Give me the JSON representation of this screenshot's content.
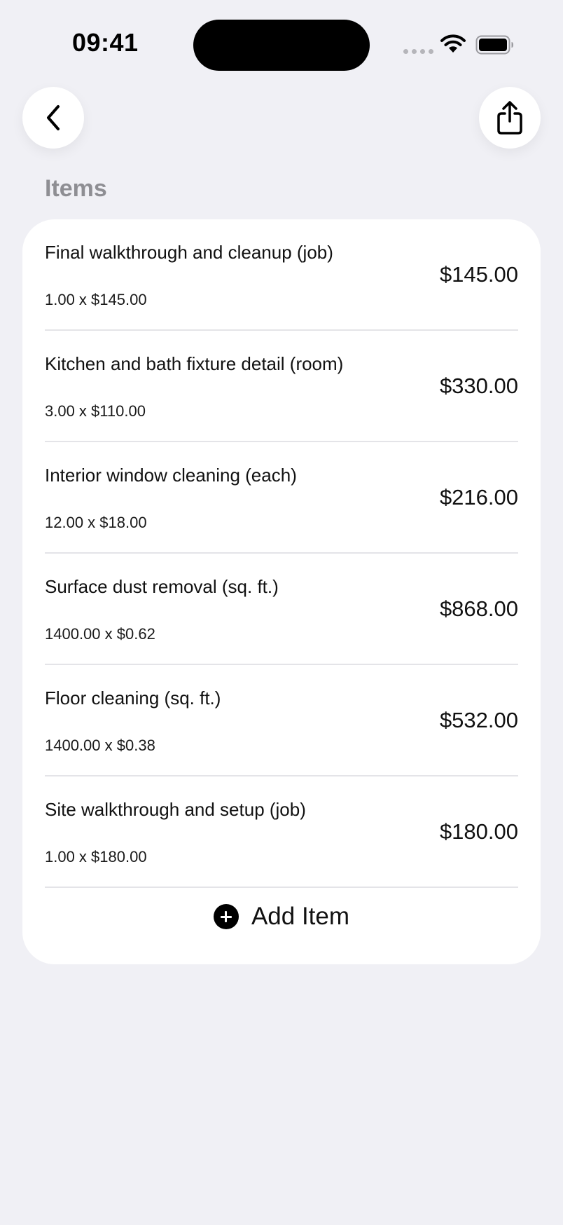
{
  "status_bar": {
    "time": "09:41"
  },
  "nav": {
    "back_icon": "chevron-left-icon",
    "share_icon": "share-icon"
  },
  "section": {
    "title": "Items"
  },
  "items": [
    {
      "name": "Final walkthrough and cleanup (job)",
      "qty_line": "1.00 x $145.00",
      "amount": "$145.00"
    },
    {
      "name": "Kitchen and bath fixture detail (room)",
      "qty_line": "3.00 x $110.00",
      "amount": "$330.00"
    },
    {
      "name": "Interior window cleaning (each)",
      "qty_line": "12.00 x $18.00",
      "amount": "$216.00"
    },
    {
      "name": "Surface dust removal (sq. ft.)",
      "qty_line": "1400.00 x $0.62",
      "amount": "$868.00"
    },
    {
      "name": "Floor cleaning (sq. ft.)",
      "qty_line": "1400.00 x $0.38",
      "amount": "$532.00"
    },
    {
      "name": "Site walkthrough and setup (job)",
      "qty_line": "1.00 x $180.00",
      "amount": "$180.00"
    }
  ],
  "add_item": {
    "label": "Add Item",
    "icon": "plus-circle-icon"
  },
  "colors": {
    "background": "#f0f0f5",
    "card": "#ffffff",
    "section_title": "#8e8e93",
    "divider": "#e4e4e8"
  }
}
